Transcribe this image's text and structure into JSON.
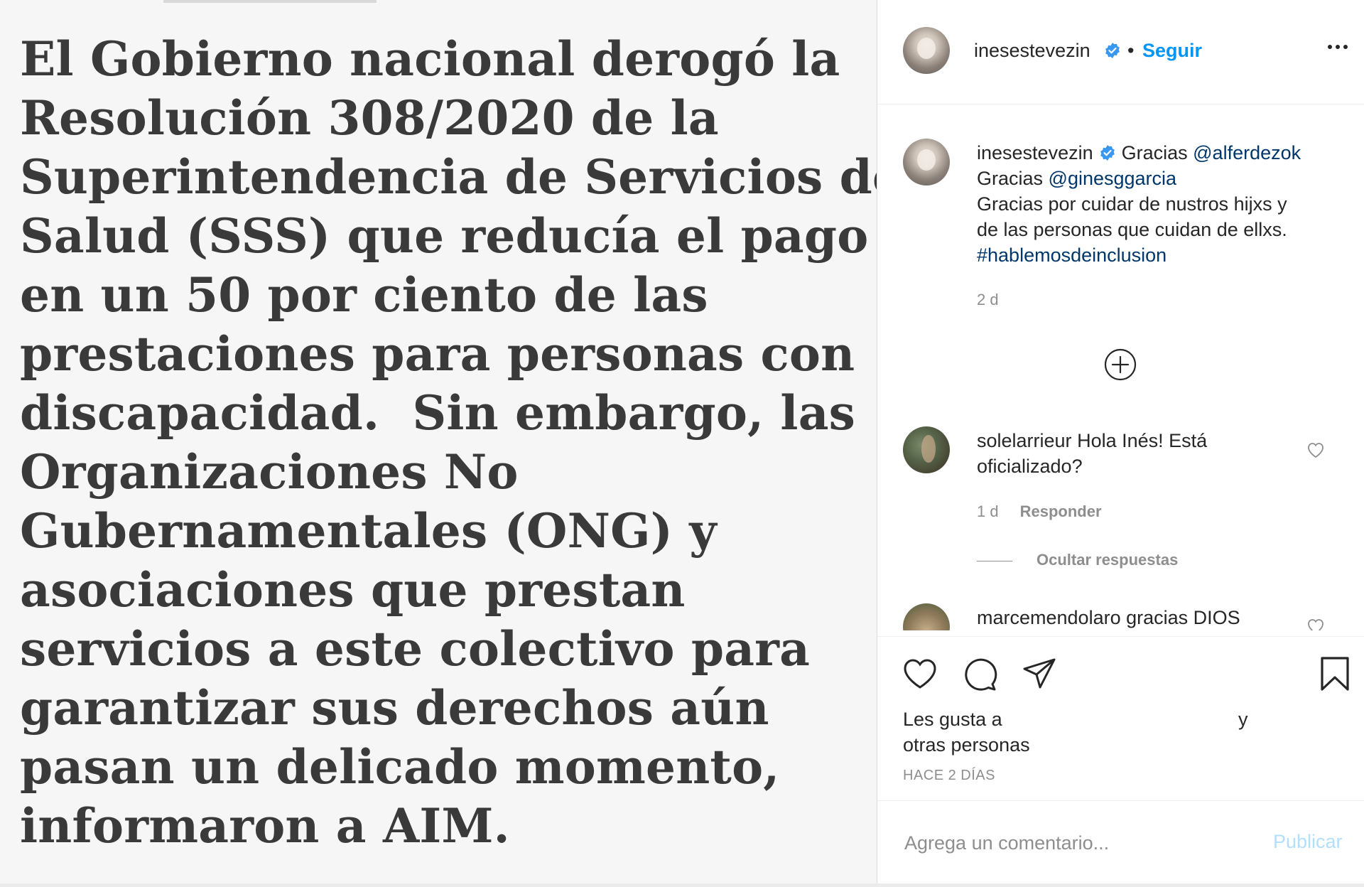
{
  "post_image": {
    "lines": [
      "El Gobierno nacional derogó la",
      "Resolución 308/2020 de la",
      "Superintendencia de Servicios de",
      "Salud (SSS) que reducía el pago",
      "en un 50 por ciento de las",
      "prestaciones para personas con",
      "discapacidad.  Sin embargo, las",
      "Organizaciones No",
      "Gubernamentales (ONG) y",
      "asociaciones que prestan",
      "servicios a este colectivo para",
      "garantizar sus derechos aún",
      "pasan un delicado momento,",
      "informaron a AIM."
    ]
  },
  "header": {
    "username": "inesestevezin",
    "separator": "•",
    "follow_label": "Seguir"
  },
  "caption": {
    "username": "inesestevezin",
    "line1_text": "Gracias ",
    "line1_mention": "@alferdezok",
    "line2_text": "Gracias ",
    "line2_mention": "@ginesggarcia",
    "line3": "Gracias por cuidar de nustros hijxs y",
    "line4": "de las personas que cuidan de ellxs.",
    "hashtag": "#hablemosdeinclusion",
    "time": "2 d"
  },
  "comments": [
    {
      "username": "solelarrieur",
      "text_line1": "Hola Inés! Está",
      "text_line2": "oficializado?",
      "time": "1 d",
      "reply_label": "Responder"
    },
    {
      "username": "marcemendolaro",
      "text_line1": "gracias DIOS"
    }
  ],
  "hide_replies_label": "Ocultar respuestas",
  "likes": {
    "prefix": "Les gusta a",
    "and": "y",
    "others": "otras personas"
  },
  "time_ago": "HACE 2 DÍAS",
  "add_comment": {
    "placeholder": "Agrega un comentario...",
    "publish_label": "Publicar"
  },
  "colors": {
    "link_blue": "#0095f6",
    "mention_blue": "#00376b",
    "muted": "#8e8e8e",
    "publish_disabled": "#b2dffc",
    "verified": "#3897f0"
  },
  "icons": [
    "verified-icon",
    "more-icon",
    "add-circle-icon",
    "heart-icon",
    "comment-icon",
    "share-icon",
    "bookmark-icon"
  ]
}
